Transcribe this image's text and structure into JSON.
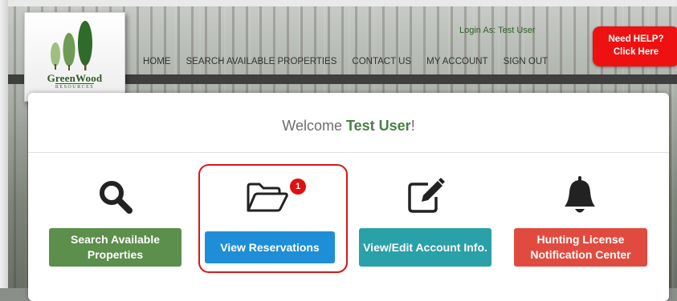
{
  "logo": {
    "name": "GreenWood",
    "sub": "RESOURCES"
  },
  "header": {
    "login_as": "Login As: Test User",
    "nav": [
      "HOME",
      "SEARCH AVAILABLE PROPERTIES",
      "CONTACT US",
      "MY ACCOUNT",
      "SIGN OUT"
    ],
    "help_line1": "Need HELP?",
    "help_line2": "Click Here"
  },
  "welcome": {
    "prefix": "Welcome ",
    "name": "Test User",
    "suffix": "!"
  },
  "cards": [
    {
      "label": "Search Available Properties",
      "icon": "search-icon"
    },
    {
      "label": "View Reservations",
      "icon": "folder-open-icon",
      "badge": "1"
    },
    {
      "label": "View/Edit Account Info.",
      "icon": "edit-icon"
    },
    {
      "label": "Hunting License Notification Center",
      "icon": "bell-icon"
    }
  ],
  "colors": {
    "green": "#5c8e4c",
    "blue": "#1e8fd6",
    "teal": "#2aa0a8",
    "red": "#e14b3f",
    "help": "#ee1111"
  }
}
